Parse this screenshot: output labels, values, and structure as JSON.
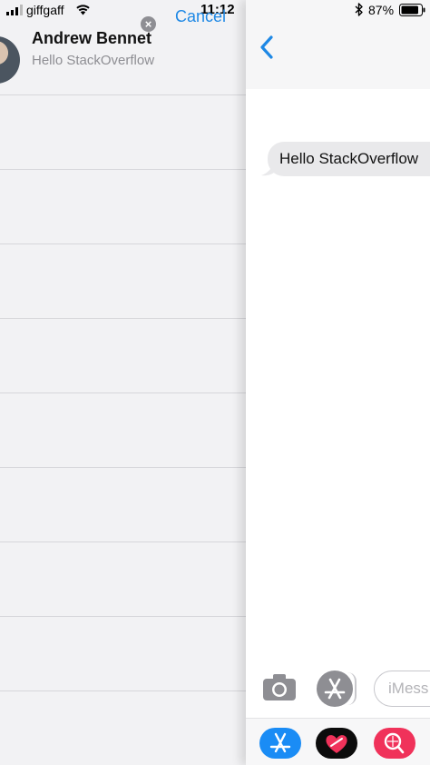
{
  "status_bar": {
    "carrier": "giffgaff",
    "time": "11:12",
    "battery": "87%",
    "icons": [
      "signal-icon",
      "wifi-icon",
      "bluetooth-icon",
      "battery-icon"
    ]
  },
  "search": {
    "cancel_label": "Cancel"
  },
  "contact": {
    "name": "Andrew Bennet",
    "preview": "Hello StackOverflow"
  },
  "conversation": {
    "messages": [
      {
        "text": "Hello StackOverflow",
        "direction": "incoming"
      }
    ],
    "input_placeholder": "iMessage",
    "visible_placeholder": "iMess"
  },
  "app_drawer": {
    "apps": [
      "app-store-icon",
      "digital-touch-icon",
      "images-search-icon"
    ]
  },
  "colors": {
    "accent": "#1e88e5",
    "incoming_bubble": "#e9e9eb",
    "list_background": "#f2f2f4",
    "search_app": "#f0325a",
    "app_store": "#1a8cf5"
  }
}
